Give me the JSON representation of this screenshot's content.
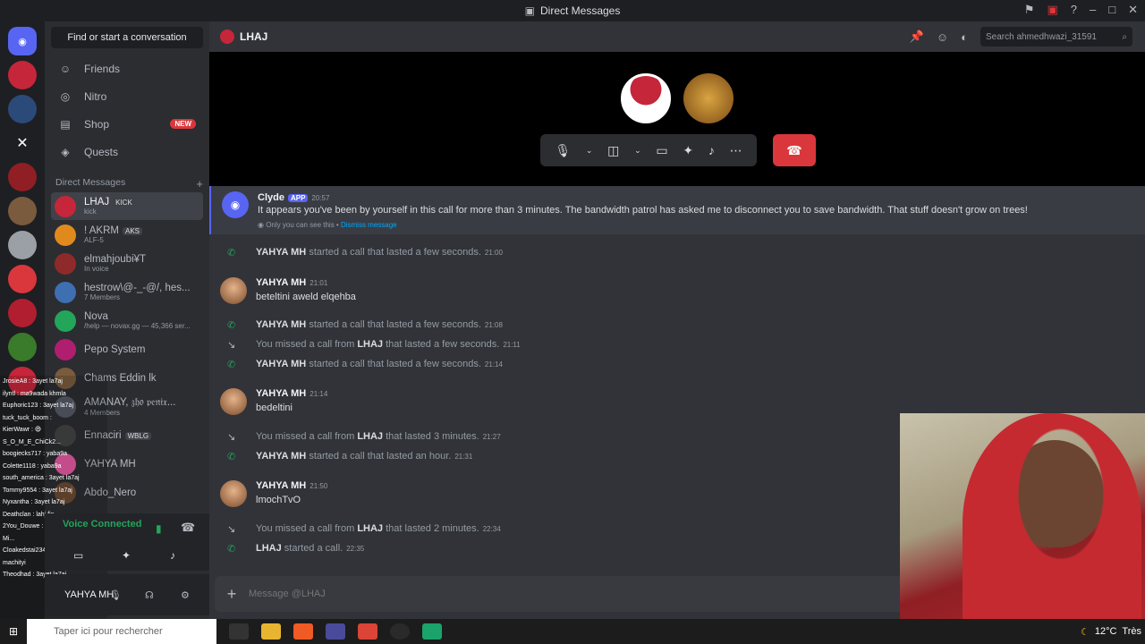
{
  "window": {
    "title": "Direct Messages"
  },
  "sidebar": {
    "find_label": "Find or start a conversation",
    "nav": [
      {
        "label": "Friends",
        "icon": "friends-icon"
      },
      {
        "label": "Nitro",
        "icon": "nitro-icon"
      },
      {
        "label": "Shop",
        "icon": "shop-icon",
        "badge": "NEW"
      },
      {
        "label": "Quests",
        "icon": "quests-icon"
      }
    ],
    "dm_header": "Direct Messages",
    "dms": [
      {
        "name": "LHAJ",
        "tag": "KICK",
        "sub": "kick",
        "active": true,
        "color": "#c5263a"
      },
      {
        "name": "! AKRM",
        "tag": "AKS",
        "sub": "ALF-5",
        "color": "#e08a1e"
      },
      {
        "name": "elmahjoubi¥T",
        "sub": "In voice",
        "color": "#8f2a2a"
      },
      {
        "name": "hestrow\\@-_-@/, hes...",
        "sub": "7 Members",
        "color": "#3e6fb0"
      },
      {
        "name": "Nova",
        "sub": "/help — novax.gg — 45,366 ser...",
        "color": "#23a55a"
      },
      {
        "name": "Pepo System",
        "color": "#b01e70"
      },
      {
        "name": "Chams Eddin lk",
        "color": "#7a5b3e"
      },
      {
        "name": "AMANAY, 𝔷𝔥𝔬 𝔭𝔢𝔫𝔦𝔵...",
        "sub": "4 Members",
        "color": "#555a66"
      },
      {
        "name": "Ennaciri",
        "tag": "WBLG",
        "color": "#444"
      },
      {
        "name": "YAHYA MH",
        "color": "#e55aa3"
      },
      {
        "name": "Abdo_Nero",
        "color": "#6d4a33"
      }
    ],
    "voice_connected": "Voice Connected",
    "user_name": "YAHYA MH"
  },
  "chat_overlay": [
    "JrosieA8 : 3ayet la7aj",
    "ilyntl : ma9wada khmla",
    "Euphoric123 : 3ayet la7aj",
    "tuck_tuck_boom :",
    "KierWawr : 😄",
    "S_O_M_E_ChiCk2...",
    "boogiecks717 : yaba9a",
    "Colette1118 : yaba9a",
    "south_america : 3ayet la7aj",
    "Tommy9554 : 3ayet la7aj",
    "Nyxantha : 3ayet la7aj",
    "Deathclan : lahj fin",
    "2You_Douwe : 😄",
    "Mi...",
    "Cloakedstai234 : la lahj 3alach machityi",
    "Theodhad : 3ayet la7aj"
  ],
  "header": {
    "name": "LHAJ",
    "search_placeholder": "Search ahmedhwazi_31591"
  },
  "clyde": {
    "name": "Clyde",
    "tag": "APP",
    "time": "20:57",
    "text": "It appears you've been by yourself in this call for more than 3 minutes. The bandwidth patrol has asked me to disconnect you to save bandwidth. That stuff doesn't grow on trees!",
    "note": "Only you can see this •",
    "dismiss": "Dismiss message"
  },
  "messages": [
    {
      "type": "call",
      "who": "YAHYA MH",
      "text": "started a call that lasted a few seconds.",
      "time": "21:00",
      "missed": false
    },
    {
      "type": "msg",
      "who": "YAHYA MH",
      "time": "21:01",
      "text": "beteltini aweld elqehba"
    },
    {
      "type": "call",
      "who": "YAHYA MH",
      "text": "started a call that lasted a few seconds.",
      "time": "21:08",
      "missed": false
    },
    {
      "type": "missed",
      "pre": "You missed a call from",
      "who": "LHAJ",
      "text": "that lasted a few seconds.",
      "time": "21:11"
    },
    {
      "type": "call",
      "who": "YAHYA MH",
      "text": "started a call that lasted a few seconds.",
      "time": "21:14"
    },
    {
      "type": "msg",
      "who": "YAHYA MH",
      "time": "21:14",
      "text": "bedeltini"
    },
    {
      "type": "missed",
      "pre": "You missed a call from",
      "who": "LHAJ",
      "text": "that lasted 3 minutes.",
      "time": "21:27"
    },
    {
      "type": "call",
      "who": "YAHYA MH",
      "text": "started a call that lasted an hour.",
      "time": "21:31"
    },
    {
      "type": "msg",
      "who": "YAHYA MH",
      "time": "21:50",
      "text": "lmochTvO"
    },
    {
      "type": "missed",
      "pre": "You missed a call from",
      "who": "LHAJ",
      "text": "that lasted 2 minutes.",
      "time": "22:34"
    },
    {
      "type": "call",
      "who": "LHAJ",
      "text": "started a call.",
      "time": "22:35"
    }
  ],
  "composer": {
    "placeholder": "Message @LHAJ"
  },
  "taskbar": {
    "search": "Taper ici pour rechercher",
    "temp": "12°C",
    "weather_text": "Très"
  }
}
